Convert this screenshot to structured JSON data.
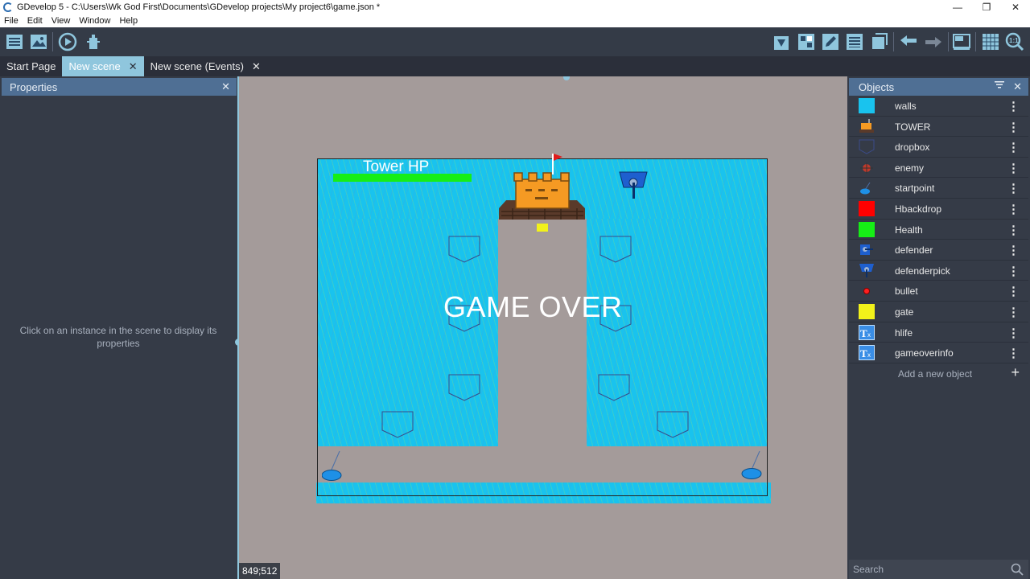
{
  "window": {
    "title": "GDevelop 5 - C:\\Users\\Wk God First\\Documents\\GDevelop projects\\My project6\\game.json *",
    "controls": {
      "minimize": "—",
      "restore": "❐",
      "close": "✕"
    }
  },
  "menu": [
    "File",
    "Edit",
    "View",
    "Window",
    "Help"
  ],
  "tabs": [
    {
      "label": "Start Page",
      "active": false,
      "closable": false
    },
    {
      "label": "New scene",
      "active": true,
      "closable": true
    },
    {
      "label": "New scene (Events)",
      "active": false,
      "closable": true
    }
  ],
  "tab_close_glyph": "✕",
  "properties": {
    "title": "Properties",
    "close_glyph": "✕",
    "empty_message": "Click on an instance in the scene to display its properties"
  },
  "scene": {
    "hp_label": "Tower HP",
    "game_over": "GAME OVER",
    "coords": "849;512",
    "colors": {
      "water": "#19c3ee",
      "road": "#a49b9a",
      "health": "#16ee16"
    }
  },
  "objects": {
    "title": "Objects",
    "filter_glyph": "⚲",
    "close_glyph": "✕",
    "more_glyph": "⋮",
    "items": [
      {
        "name": "walls",
        "icon": "walls-icon",
        "color": "#19c3ee"
      },
      {
        "name": "TOWER",
        "icon": "tower-icon",
        "color": "#f59a23"
      },
      {
        "name": "dropbox",
        "icon": "dropbox-icon",
        "color": "#3b4b8a"
      },
      {
        "name": "enemy",
        "icon": "enemy-icon",
        "color": "#c0392b"
      },
      {
        "name": "startpoint",
        "icon": "startpoint-icon",
        "color": "#1e90e6"
      },
      {
        "name": "Hbackdrop",
        "icon": "hbackdrop-icon",
        "color": "#ff0000"
      },
      {
        "name": "Health",
        "icon": "health-icon",
        "color": "#16ee16"
      },
      {
        "name": "defender",
        "icon": "defender-icon",
        "color": "#1e5fcf"
      },
      {
        "name": "defenderpick",
        "icon": "defenderpick-icon",
        "color": "#1e5fcf"
      },
      {
        "name": "bullet",
        "icon": "bullet-icon",
        "color": "#ff2020"
      },
      {
        "name": "gate",
        "icon": "gate-icon",
        "color": "#f2f21a"
      },
      {
        "name": "hlife",
        "icon": "text-object-icon",
        "color": "#3a8ee6"
      },
      {
        "name": "gameoverinfo",
        "icon": "text-object-icon",
        "color": "#3a8ee6"
      }
    ],
    "add_label": "Add a new object",
    "add_glyph": "+",
    "search_placeholder": "Search"
  }
}
